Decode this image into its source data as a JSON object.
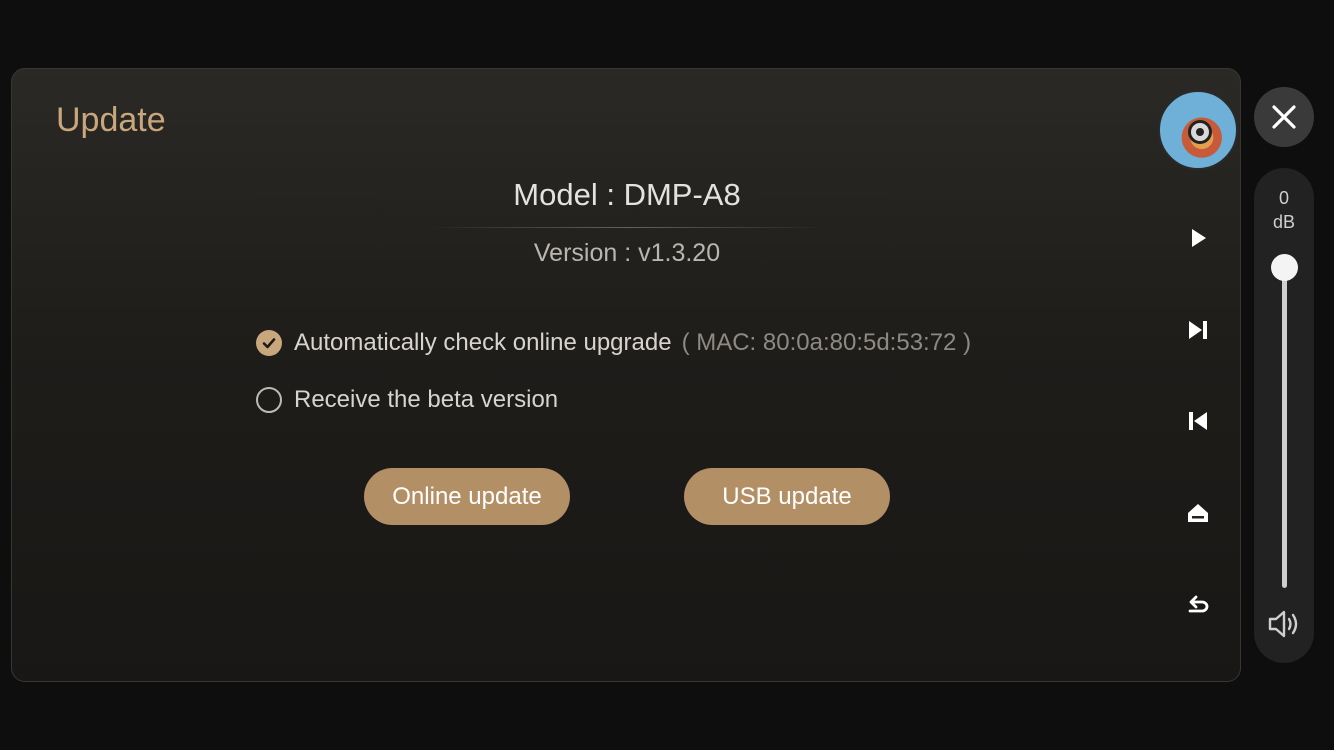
{
  "dialog": {
    "title": "Update",
    "model_text": "Model : DMP-A8",
    "version_text": "Version : v1.3.20",
    "options": [
      {
        "label": "Automatically check online upgrade",
        "extra": "( MAC: 80:0a:80:5d:53:72 )",
        "checked": true
      },
      {
        "label": "Receive the beta version",
        "checked": false
      }
    ],
    "buttons": {
      "online": "Online update",
      "usb": "USB update"
    }
  },
  "sidebar": {
    "controls": [
      "play-icon",
      "next-track-icon",
      "previous-track-icon",
      "eject-icon",
      "back-icon"
    ]
  },
  "volume": {
    "value": "0",
    "unit": "dB",
    "level": 1.0
  },
  "colors": {
    "accent": "#c9a77c",
    "button": "#b38f66",
    "background": "#0e0e0e"
  }
}
